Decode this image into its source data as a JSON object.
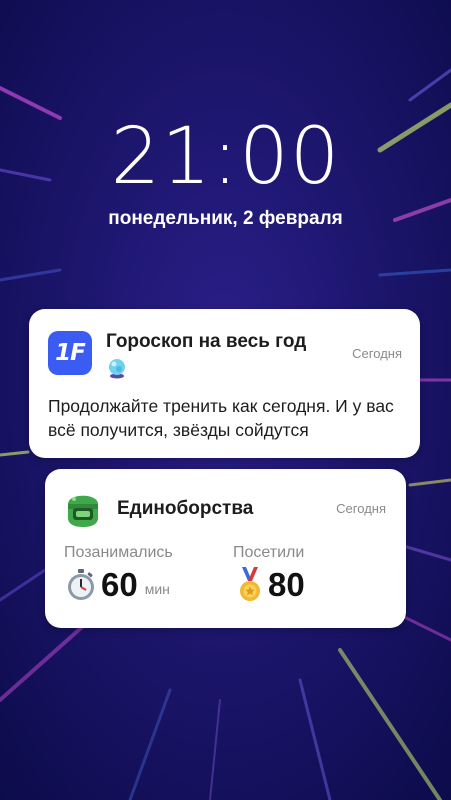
{
  "lockscreen": {
    "time": "21:00",
    "date": "понедельник, 2 февраля"
  },
  "notifications": [
    {
      "app_icon": "1f-app-icon",
      "app_icon_text": "1F",
      "title": "Гороскоп на весь год",
      "title_emoji": "crystal-ball-icon",
      "time": "Сегодня",
      "body": "Продолжайте тренить как сегодня. И у вас всё получится, звёзды сойдутся"
    },
    {
      "app_icon": "boxing-helmet-icon",
      "title": "Единоборства",
      "time": "Сегодня",
      "stats": [
        {
          "label": "Позанимались",
          "icon": "stopwatch-icon",
          "value": "60",
          "unit": "мин"
        },
        {
          "label": "Посетили",
          "icon": "medal-icon",
          "value": "80"
        }
      ]
    }
  ],
  "colors": {
    "background": "#14125e",
    "accent_blue": "#3a5cf2",
    "helmet_green": "#3ea84a"
  }
}
